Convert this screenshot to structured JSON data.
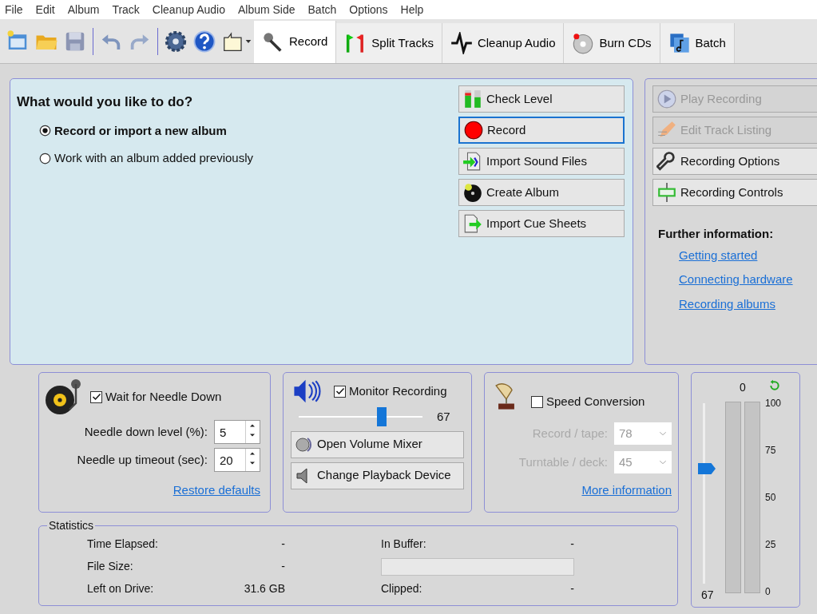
{
  "menu": [
    "File",
    "Edit",
    "Album",
    "Track",
    "Cleanup Audio",
    "Album Side",
    "Batch",
    "Options",
    "Help"
  ],
  "tabs": [
    {
      "label": "Record",
      "selected": true
    },
    {
      "label": "Split Tracks",
      "selected": false
    },
    {
      "label": "Cleanup Audio",
      "selected": false
    },
    {
      "label": "Burn CDs",
      "selected": false
    },
    {
      "label": "Batch",
      "selected": false
    }
  ],
  "task_panel": {
    "heading": "What would you like to do?",
    "options": [
      {
        "label": "Record or import a new album",
        "selected": true
      },
      {
        "label": "Work with an album added previously",
        "selected": false
      }
    ],
    "buttons": [
      {
        "label": "Check Level",
        "focused": false
      },
      {
        "label": "Record",
        "focused": true
      },
      {
        "label": "Import Sound Files",
        "focused": false
      },
      {
        "label": "Create Album",
        "focused": false
      },
      {
        "label": "Import Cue Sheets",
        "focused": false
      }
    ]
  },
  "side_panel": {
    "buttons": [
      {
        "label": "Play Recording",
        "disabled": true
      },
      {
        "label": "Edit Track Listing",
        "disabled": true
      },
      {
        "label": "Recording Options",
        "disabled": false
      },
      {
        "label": "Recording Controls",
        "disabled": false
      }
    ],
    "further_heading": "Further information:",
    "links": [
      "Getting started",
      "Connecting hardware",
      "Recording albums"
    ]
  },
  "needle": {
    "checkbox": {
      "label": "Wait for Needle Down",
      "checked": true
    },
    "fields": [
      {
        "label": "Needle down level (%):",
        "value": "5"
      },
      {
        "label": "Needle up timeout (sec):",
        "value": "20"
      }
    ],
    "link": "Restore defaults"
  },
  "monitor": {
    "checkbox": {
      "label": "Monitor Recording",
      "checked": true
    },
    "slider": {
      "level": 0.67,
      "reading": "67"
    },
    "buttons": [
      "Open Volume Mixer",
      "Change Playback Device"
    ]
  },
  "speed": {
    "checkbox": {
      "label": "Speed Conversion",
      "checked": false
    },
    "disabled": true,
    "selects": [
      {
        "label": "Record / tape:",
        "value": "78"
      },
      {
        "label": "Turntable / deck:",
        "value": "45"
      }
    ],
    "link": "More information"
  },
  "meter": {
    "top_reading": "0",
    "bottom_reading": "67",
    "ticks": [
      "100",
      "75",
      "50",
      "25",
      "0"
    ],
    "input": {
      "level": 0.7
    }
  },
  "statistics": {
    "title": "Statistics",
    "left": [
      {
        "label": "Time Elapsed:",
        "value": "-"
      },
      {
        "label": "File Size:",
        "value": "-"
      },
      {
        "label": "Left on Drive:",
        "value": "31.6 GB"
      }
    ],
    "right": [
      {
        "label": "In Buffer:",
        "value": "-"
      },
      {
        "kind": "bar"
      },
      {
        "label": "Clipped:",
        "value": "-"
      }
    ]
  }
}
